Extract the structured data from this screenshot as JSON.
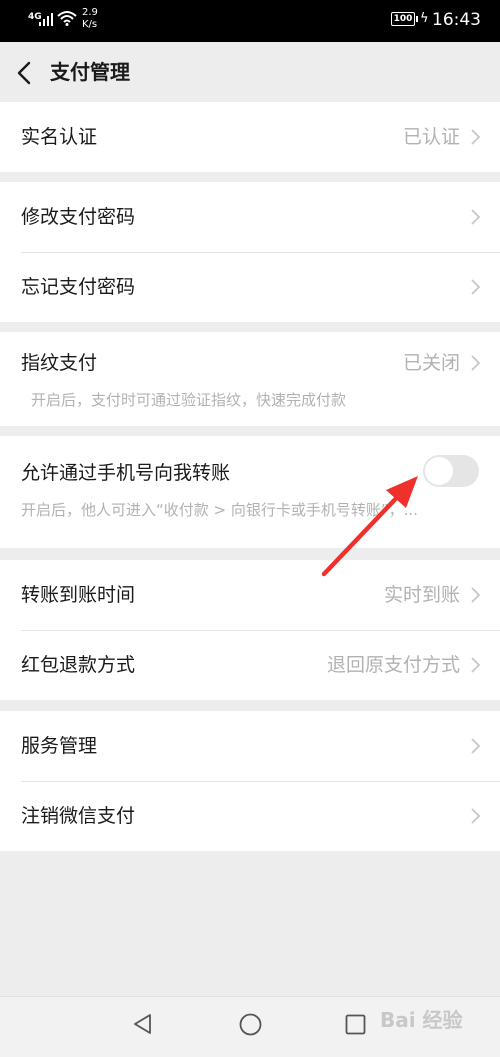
{
  "status_bar": {
    "signal": "4G",
    "speed_value": "2.9",
    "speed_unit": "K/s",
    "battery": "100",
    "time": "16:43"
  },
  "header": {
    "title": "支付管理"
  },
  "groups": {
    "identity": {
      "label": "实名认证",
      "value": "已认证"
    },
    "password": {
      "change_label": "修改支付密码",
      "forgot_label": "忘记支付密码"
    },
    "fingerprint": {
      "label": "指纹支付",
      "value": "已关闭",
      "description": "开启后，支付时可通过验证指纹，快速完成付款"
    },
    "phone_transfer": {
      "label": "允许通过手机号向我转账",
      "description": "开启后，他人可进入“收付款 > 向银行卡或手机号转账”，...",
      "enabled": false
    },
    "transfer": {
      "arrival_label": "转账到账时间",
      "arrival_value": "实时到账",
      "refund_label": "红包退款方式",
      "refund_value": "退回原支付方式"
    },
    "service": {
      "manage_label": "服务管理",
      "cancel_label": "注销微信支付"
    }
  },
  "watermark": "Bai 经验",
  "colors": {
    "background": "#ededed",
    "secondary_text": "#b2b2b2",
    "annotation_arrow": "#f0302a"
  }
}
